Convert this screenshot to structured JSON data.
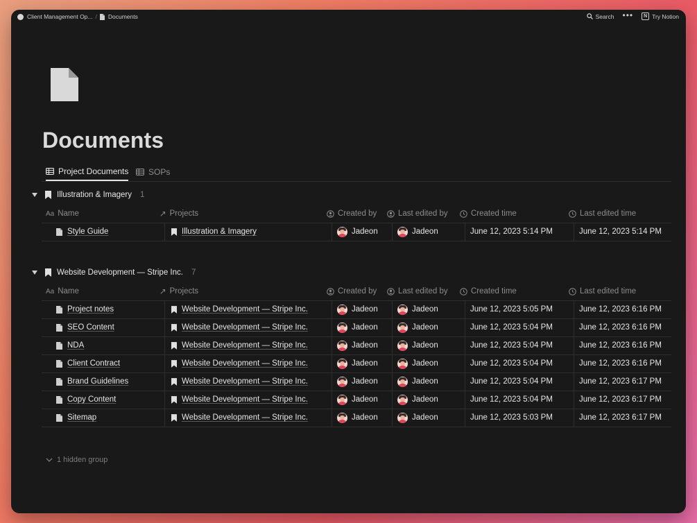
{
  "topbar": {
    "workspace": "Client Management Op...",
    "page": "Documents",
    "search_label": "Search",
    "more_label": "•••",
    "try_label": "Try Notion"
  },
  "page": {
    "title": "Documents",
    "icon": "document-icon"
  },
  "tabs": [
    {
      "label": "Project Documents",
      "active": true
    },
    {
      "label": "SOPs",
      "active": false
    }
  ],
  "columns": {
    "name_prefix": "Aa",
    "name": "Name",
    "projects": "Projects",
    "created_by": "Created by",
    "last_edited_by": "Last edited by",
    "created_time": "Created time",
    "last_edited_time": "Last edited time"
  },
  "groups": [
    {
      "name": "Illustration & Imagery",
      "count": "1",
      "rows": [
        {
          "name": "Style Guide",
          "project": "Illustration & Imagery",
          "created_by": "Jadeon",
          "last_edited_by": "Jadeon",
          "created_time": "June 12, 2023 5:14 PM",
          "last_edited_time": "June 12, 2023 5:14 PM"
        }
      ]
    },
    {
      "name": "Website Development — Stripe Inc.",
      "count": "7",
      "rows": [
        {
          "name": "Project notes",
          "project": "Website Development — Stripe Inc.",
          "created_by": "Jadeon",
          "last_edited_by": "Jadeon",
          "created_time": "June 12, 2023 5:05 PM",
          "last_edited_time": "June 12, 2023 6:16 PM"
        },
        {
          "name": "SEO Content",
          "project": "Website Development — Stripe Inc.",
          "created_by": "Jadeon",
          "last_edited_by": "Jadeon",
          "created_time": "June 12, 2023 5:04 PM",
          "last_edited_time": "June 12, 2023 6:16 PM"
        },
        {
          "name": "NDA",
          "project": "Website Development — Stripe Inc.",
          "created_by": "Jadeon",
          "last_edited_by": "Jadeon",
          "created_time": "June 12, 2023 5:04 PM",
          "last_edited_time": "June 12, 2023 6:16 PM"
        },
        {
          "name": "Client Contract",
          "project": "Website Development — Stripe Inc.",
          "created_by": "Jadeon",
          "last_edited_by": "Jadeon",
          "created_time": "June 12, 2023 5:04 PM",
          "last_edited_time": "June 12, 2023 6:16 PM"
        },
        {
          "name": "Brand Guidelines",
          "project": "Website Development — Stripe Inc.",
          "created_by": "Jadeon",
          "last_edited_by": "Jadeon",
          "created_time": "June 12, 2023 5:04 PM",
          "last_edited_time": "June 12, 2023 6:17 PM"
        },
        {
          "name": "Copy Content",
          "project": "Website Development — Stripe Inc.",
          "created_by": "Jadeon",
          "last_edited_by": "Jadeon",
          "created_time": "June 12, 2023 5:04 PM",
          "last_edited_time": "June 12, 2023 6:17 PM"
        },
        {
          "name": "Sitemap",
          "project": "Website Development — Stripe Inc.",
          "created_by": "Jadeon",
          "last_edited_by": "Jadeon",
          "created_time": "June 12, 2023 5:03 PM",
          "last_edited_time": "June 12, 2023 6:17 PM"
        }
      ]
    }
  ],
  "hidden_groups_label": "1 hidden group"
}
